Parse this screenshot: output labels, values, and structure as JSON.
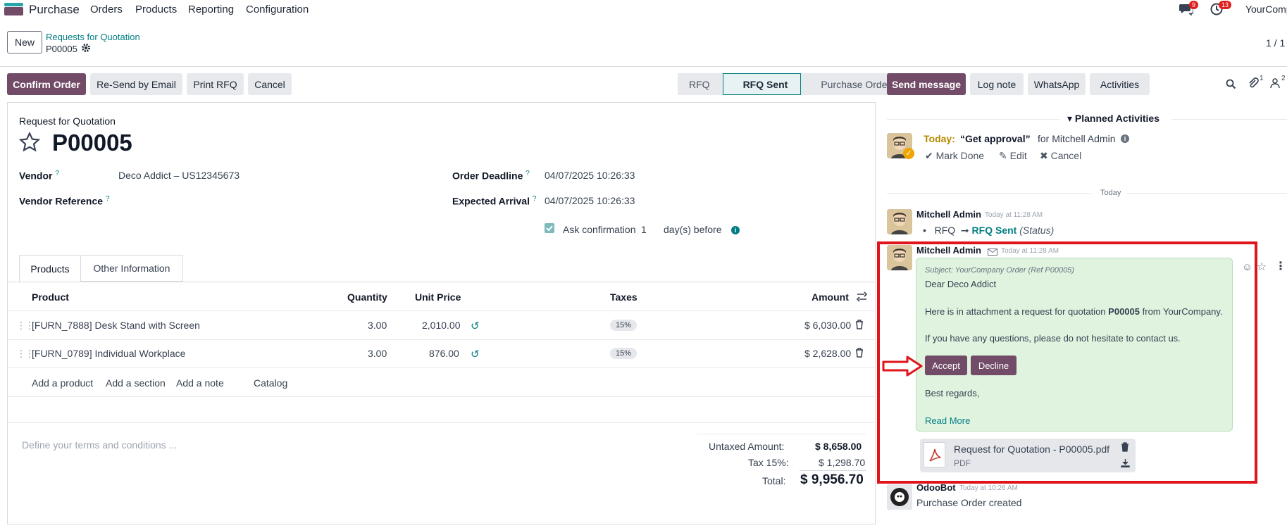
{
  "nav": {
    "brand": "Purchase",
    "items": [
      "Orders",
      "Products",
      "Reporting",
      "Configuration"
    ],
    "chat_count": "9",
    "activity_count": "13",
    "company": "YourComp"
  },
  "control": {
    "new_label": "New",
    "breadcrumb": "Requests for Quotation",
    "record": "P00005",
    "pager": "1 / 1"
  },
  "actions": {
    "confirm": "Confirm Order",
    "resend": "Re-Send by Email",
    "print": "Print RFQ",
    "cancel": "Cancel"
  },
  "stages": [
    "RFQ",
    "RFQ Sent",
    "Purchase Order"
  ],
  "form": {
    "heading": "Request for Quotation",
    "name": "P00005",
    "vendor_label": "Vendor",
    "vendor_value": "Deco Addict – US12345673",
    "vendor_ref_label": "Vendor Reference",
    "deadline_label": "Order Deadline",
    "deadline_value": "04/07/2025 10:26:33",
    "arrival_label": "Expected Arrival",
    "arrival_value": "04/07/2025 10:26:33",
    "confirm_label": "Ask confirmation",
    "confirm_days": "1",
    "confirm_suffix": "day(s) before",
    "help_mark": "?"
  },
  "tabs": [
    "Products",
    "Other Information"
  ],
  "table": {
    "headers": [
      "Product",
      "Quantity",
      "Unit Price",
      "Taxes",
      "Amount"
    ],
    "rows": [
      {
        "product": "[FURN_7888] Desk Stand with Screen",
        "qty": "3.00",
        "price": "2,010.00",
        "tax": "15%",
        "amount": "$ 6,030.00"
      },
      {
        "product": "[FURN_0789] Individual Workplace",
        "qty": "3.00",
        "price": "876.00",
        "tax": "15%",
        "amount": "$ 2,628.00"
      }
    ],
    "add_links": [
      "Add a product",
      "Add a section",
      "Add a note",
      "Catalog"
    ]
  },
  "terms_placeholder": "Define your terms and conditions ...",
  "totals": {
    "untaxed_label": "Untaxed Amount:",
    "untaxed_value": "$ 8,658.00",
    "tax_label": "Tax 15%:",
    "tax_value": "$ 1,298.70",
    "total_label": "Total:",
    "total_value": "$ 9,956.70"
  },
  "chatter": {
    "send": "Send message",
    "log": "Log note",
    "whatsapp": "WhatsApp",
    "activities": "Activities",
    "attach_count": "1",
    "follower_count": "2",
    "planned_title": "Planned Activities",
    "activity_today": "Today:",
    "activity_name": "“Get approval”",
    "activity_for": "for Mitchell Admin",
    "mark_done": "Mark Done",
    "edit": "Edit",
    "cancel": "Cancel",
    "day_sep": "Today",
    "msg1_author": "Mitchell Admin",
    "msg1_time": "Today at 11:28 AM",
    "msg1_from": "RFQ",
    "msg1_to": "RFQ Sent",
    "msg1_field": "(Status)",
    "msg2_author": "Mitchell Admin",
    "msg2_time": "Today at 11:28 AM",
    "subject": "Subject: YourCompany Order (Ref P00005)",
    "greeting": "Dear Deco Addict",
    "body_pre": "Here is in attachment a request for quotation",
    "body_ref": "P00005",
    "body_post": "from YourCompany.",
    "body2": "If you have any questions, please do not hesitate to contact us.",
    "accept": "Accept",
    "decline": "Decline",
    "regards": "Best regards,",
    "read_more": "Read More",
    "attachment_name": "Request for Quotation - P00005.pdf",
    "attachment_type": "PDF",
    "msg3_author": "OdooBot",
    "msg3_time": "Today at 10:26 AM",
    "msg3_body": "Purchase Order created"
  }
}
